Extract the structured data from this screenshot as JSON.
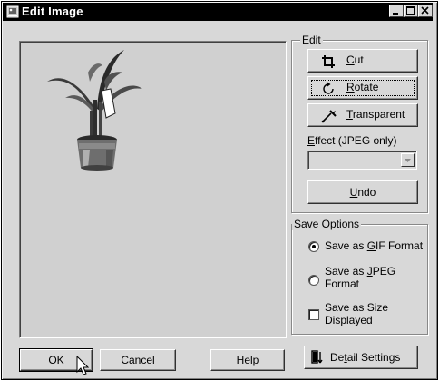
{
  "window": {
    "title": "Edit Image"
  },
  "edit_group": {
    "label": "Edit",
    "cut_label": "Cut",
    "cut_key": "C",
    "rotate_label": "Rotate",
    "rotate_key": "R",
    "transparent_label": "Transparent",
    "transparent_key": "T",
    "effect_label": "Effect (JPEG only)",
    "effect_key": "E",
    "effect_value": "",
    "undo_label": "Undo",
    "undo_key": "U"
  },
  "save_options": {
    "label": "Save Options",
    "gif_label_pre": "Save as ",
    "gif_key": "G",
    "gif_label_post": "IF Format",
    "gif_selected": true,
    "jpeg_label_line1_pre": "Save as ",
    "jpeg_key": "J",
    "jpeg_label_line1_post": "PEG",
    "jpeg_label_line2": "Format",
    "jpeg_selected": false,
    "size_label_line1": "Save as Size",
    "size_label_line2": "Displayed",
    "size_checked": false
  },
  "footer": {
    "ok_label": "OK",
    "cancel_label": "Cancel",
    "help_label": "Help",
    "help_key": "H",
    "detail_label_pre": "De",
    "detail_key": "t",
    "detail_label_post": "ail Settings"
  }
}
